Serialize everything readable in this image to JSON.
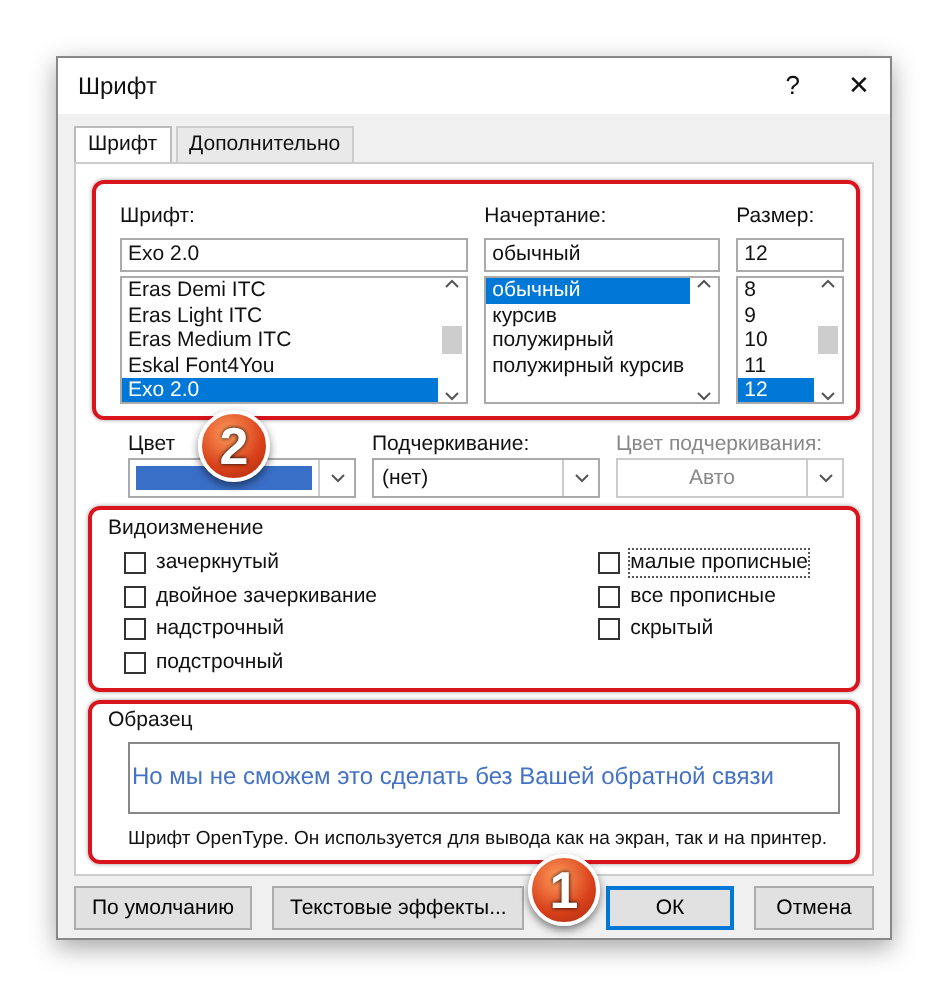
{
  "window": {
    "title": "Шрифт",
    "help": "?",
    "close": "✕"
  },
  "tabs": [
    {
      "label": "Шрифт",
      "selected": true
    },
    {
      "label": "Дополнительно",
      "selected": false
    }
  ],
  "font": {
    "label": "Шрифт:",
    "value": "Exo 2.0",
    "items": [
      {
        "text": "Eras Demi ITC",
        "selected": false
      },
      {
        "text": "Eras Light ITC",
        "selected": false
      },
      {
        "text": "Eras Medium ITC",
        "selected": false
      },
      {
        "text": "Eskal Font4You",
        "selected": false
      },
      {
        "text": "Exo 2.0",
        "selected": true
      }
    ]
  },
  "style": {
    "label": "Начертание:",
    "value": "обычный",
    "items": [
      {
        "text": "обычный",
        "selected": true
      },
      {
        "text": "курсив",
        "selected": false
      },
      {
        "text": "полужирный",
        "selected": false
      },
      {
        "text": "полужирный курсив",
        "selected": false
      }
    ]
  },
  "size": {
    "label": "Размер:",
    "value": "12",
    "items": [
      {
        "text": "8",
        "selected": false
      },
      {
        "text": "9",
        "selected": false
      },
      {
        "text": "10",
        "selected": false
      },
      {
        "text": "11",
        "selected": false
      },
      {
        "text": "12",
        "selected": true
      }
    ]
  },
  "color": {
    "label": "Цвет",
    "color": "#3a6fc8"
  },
  "underline": {
    "label": "Подчеркивание:",
    "value": "(нет)"
  },
  "underline_color": {
    "label": "Цвет подчеркивания:",
    "value": "Авто",
    "disabled": true
  },
  "effects": {
    "title": "Видоизменение",
    "left": [
      {
        "label": "зачеркнутый",
        "checked": false,
        "focused": false
      },
      {
        "label": "двойное зачеркивание",
        "checked": false,
        "focused": false
      },
      {
        "label": "надстрочный",
        "checked": false,
        "focused": false
      },
      {
        "label": "подстрочный",
        "checked": false,
        "focused": false
      }
    ],
    "right": [
      {
        "label": "малые прописные",
        "checked": false,
        "focused": true
      },
      {
        "label": "все прописные",
        "checked": false,
        "focused": false
      },
      {
        "label": "скрытый",
        "checked": false,
        "focused": false
      }
    ]
  },
  "preview": {
    "title": "Образец",
    "sample": "Но мы не сможем это сделать без Вашей обратной связи",
    "note": "Шрифт OpenType. Он используется для вывода как на экран, так и на принтер."
  },
  "buttons": [
    {
      "label": "По умолчанию",
      "default": false
    },
    {
      "label": "Текстовые эффекты...",
      "default": false
    },
    {
      "label": "ОК",
      "default": true
    },
    {
      "label": "Отмена",
      "default": false
    }
  ],
  "annotations": [
    {
      "number": "2"
    },
    {
      "number": "1"
    }
  ]
}
